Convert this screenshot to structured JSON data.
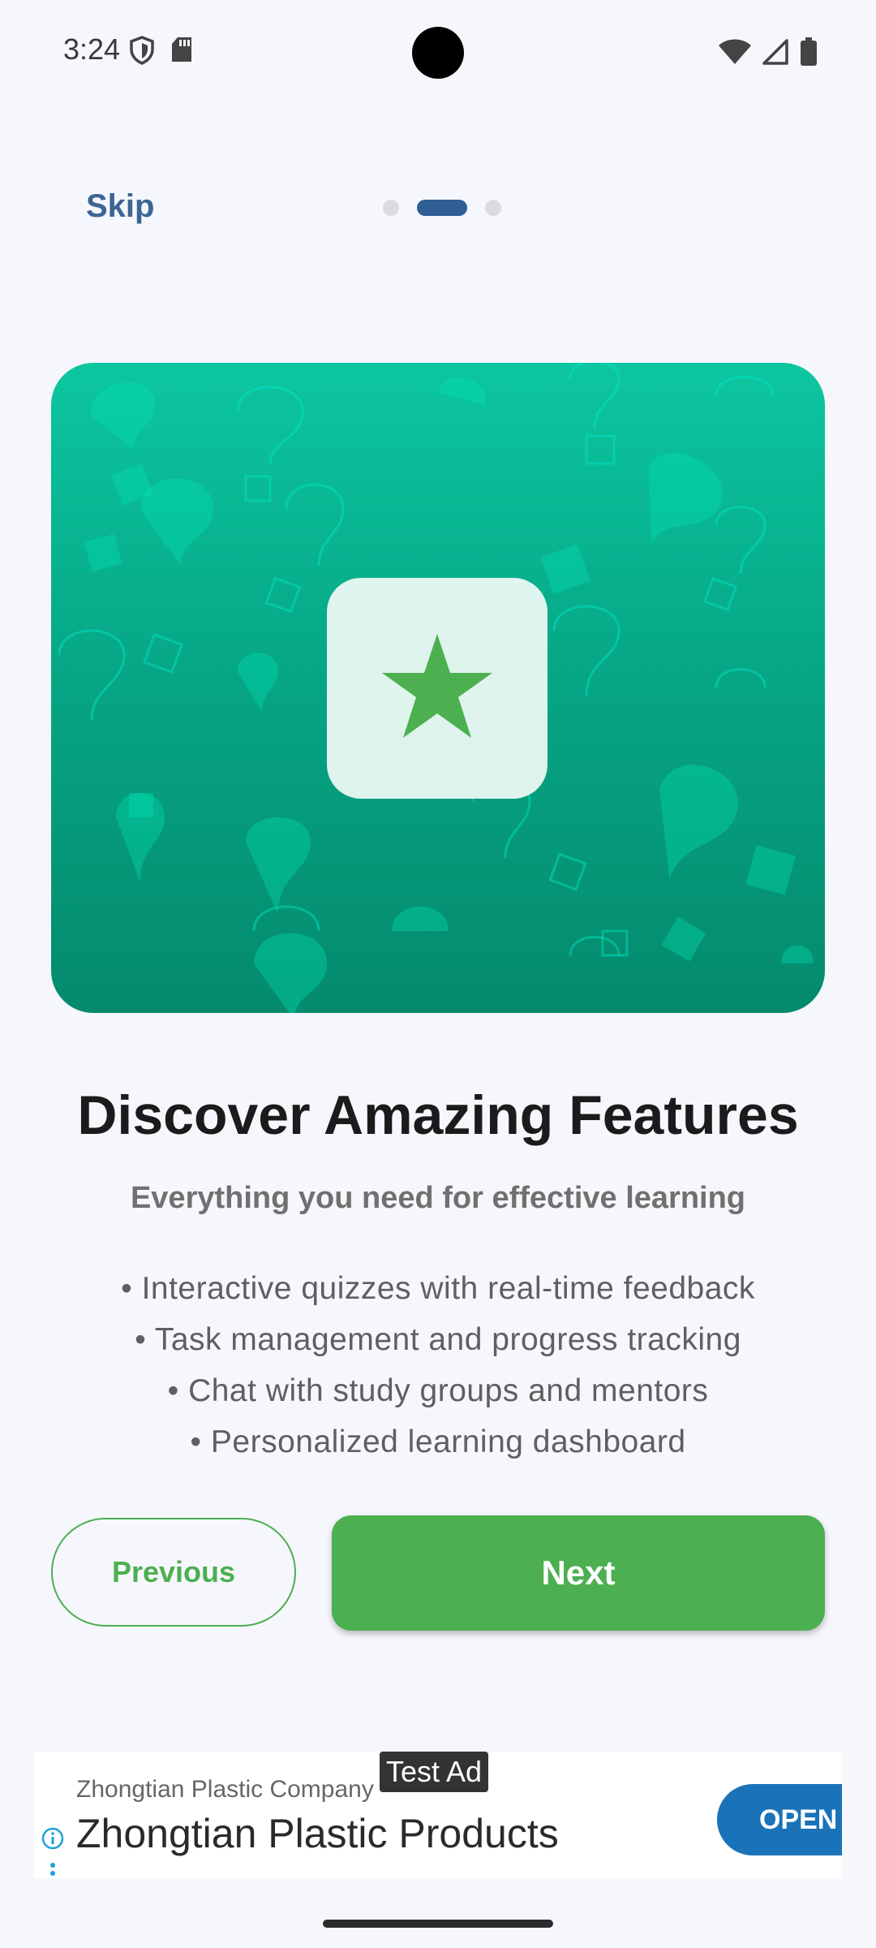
{
  "status_bar": {
    "time": "3:24",
    "left_icons": [
      "shield-icon",
      "sd-card-icon"
    ],
    "right_icons": [
      "wifi-icon",
      "cell-signal-icon",
      "battery-icon"
    ]
  },
  "nav": {
    "skip_label": "Skip",
    "page_indicator": {
      "total": 3,
      "current": 2
    }
  },
  "hero": {
    "icon": "star-icon",
    "accent_color": "#4caf50",
    "background": "question-mark-pattern"
  },
  "content": {
    "title": "Discover Amazing Features",
    "subtitle": "Everything you need for effective learning",
    "features": [
      "• Interactive quizzes with real-time feedback",
      "• Task management and progress tracking",
      "• Chat with study groups and mentors",
      "• Personalized learning dashboard"
    ]
  },
  "buttons": {
    "previous_label": "Previous",
    "next_label": "Next"
  },
  "ad": {
    "label": "Test Ad",
    "company": "Zhongtian Plastic Company",
    "title": "Zhongtian Plastic Products",
    "cta": "OPEN"
  }
}
